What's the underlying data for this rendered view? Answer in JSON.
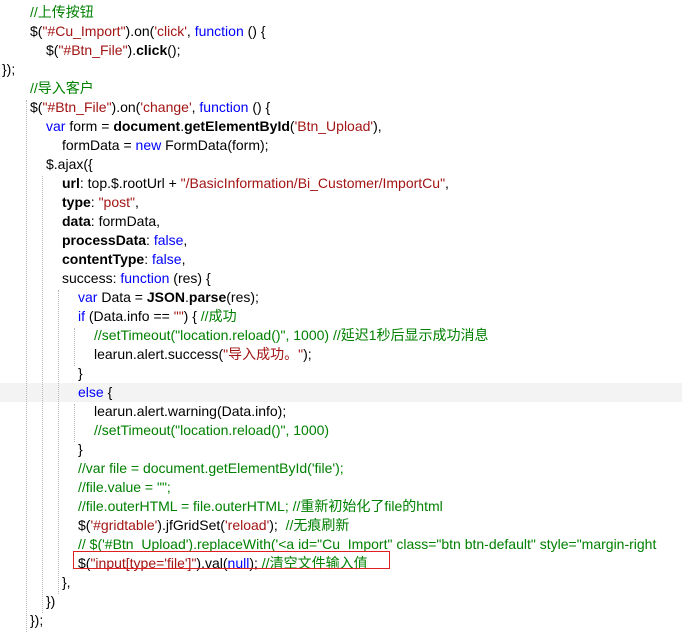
{
  "code": {
    "lines": [
      {
        "indent": 1,
        "tokens": [
          {
            "t": "//上传按钮",
            "c": "c"
          }
        ]
      },
      {
        "indent": 1,
        "tokens": [
          {
            "t": "$(",
            "c": "p"
          },
          {
            "t": "\"#Cu_Import\"",
            "c": "s"
          },
          {
            "t": ").on(",
            "c": "p"
          },
          {
            "t": "'click'",
            "c": "s"
          },
          {
            "t": ", ",
            "c": "p"
          },
          {
            "t": "function",
            "c": "k"
          },
          {
            "t": " () {",
            "c": "p"
          }
        ]
      },
      {
        "indent": 2,
        "tokens": [
          {
            "t": "$(",
            "c": "p"
          },
          {
            "t": "\"#Btn_File\"",
            "c": "s"
          },
          {
            "t": ").",
            "c": "p"
          },
          {
            "t": "click",
            "c": "b"
          },
          {
            "t": "();",
            "c": "p"
          }
        ]
      },
      {
        "indent": 0,
        "tokens": [
          {
            "t": "});",
            "c": "p"
          }
        ]
      },
      {
        "indent": 1,
        "tokens": [
          {
            "t": "//导入客户",
            "c": "c"
          }
        ]
      },
      {
        "indent": 1,
        "tokens": [
          {
            "t": "$(",
            "c": "p"
          },
          {
            "t": "\"#Btn_File\"",
            "c": "s"
          },
          {
            "t": ").on(",
            "c": "p"
          },
          {
            "t": "'change'",
            "c": "s"
          },
          {
            "t": ", ",
            "c": "p"
          },
          {
            "t": "function",
            "c": "k"
          },
          {
            "t": " () {",
            "c": "p"
          }
        ]
      },
      {
        "indent": 3,
        "tokens": [
          {
            "t": "var",
            "c": "k"
          },
          {
            "t": " form = ",
            "c": "p"
          },
          {
            "t": "document",
            "c": "b"
          },
          {
            "t": ".",
            "c": "p"
          },
          {
            "t": "getElementById",
            "c": "b"
          },
          {
            "t": "(",
            "c": "p"
          },
          {
            "t": "'Btn_Upload'",
            "c": "s"
          },
          {
            "t": "),",
            "c": "p"
          }
        ]
      },
      {
        "indent": 4,
        "tokens": [
          {
            "t": "formData = ",
            "c": "p"
          },
          {
            "t": "new",
            "c": "k"
          },
          {
            "t": " FormData(form);",
            "c": "p"
          }
        ]
      },
      {
        "indent": 3,
        "tokens": [
          {
            "t": "$.ajax({",
            "c": "p"
          }
        ]
      },
      {
        "indent": 4,
        "tokens": [
          {
            "t": "url",
            "c": "b"
          },
          {
            "t": ": top.$.rootUrl + ",
            "c": "p"
          },
          {
            "t": "\"/BasicInformation/Bi_Customer/ImportCu\"",
            "c": "s"
          },
          {
            "t": ",",
            "c": "p"
          }
        ]
      },
      {
        "indent": 4,
        "tokens": [
          {
            "t": "type",
            "c": "b"
          },
          {
            "t": ": ",
            "c": "p"
          },
          {
            "t": "\"post\"",
            "c": "s"
          },
          {
            "t": ",",
            "c": "p"
          }
        ]
      },
      {
        "indent": 4,
        "tokens": [
          {
            "t": "data",
            "c": "b"
          },
          {
            "t": ": formData,",
            "c": "p"
          }
        ]
      },
      {
        "indent": 4,
        "tokens": [
          {
            "t": "processData",
            "c": "b"
          },
          {
            "t": ": ",
            "c": "p"
          },
          {
            "t": "false",
            "c": "k"
          },
          {
            "t": ",",
            "c": "p"
          }
        ]
      },
      {
        "indent": 4,
        "tokens": [
          {
            "t": "contentType",
            "c": "b"
          },
          {
            "t": ": ",
            "c": "p"
          },
          {
            "t": "false",
            "c": "k"
          },
          {
            "t": ",",
            "c": "p"
          }
        ]
      },
      {
        "indent": 4,
        "tokens": [
          {
            "t": "success: ",
            "c": "p"
          },
          {
            "t": "function",
            "c": "k"
          },
          {
            "t": " (res) {",
            "c": "p"
          }
        ]
      },
      {
        "indent": 5,
        "tokens": [
          {
            "t": "var",
            "c": "k"
          },
          {
            "t": " Data = ",
            "c": "p"
          },
          {
            "t": "JSON",
            "c": "b"
          },
          {
            "t": ".",
            "c": "p"
          },
          {
            "t": "parse",
            "c": "b"
          },
          {
            "t": "(res);",
            "c": "p"
          }
        ]
      },
      {
        "indent": 5,
        "tokens": [
          {
            "t": "if",
            "c": "k"
          },
          {
            "t": " (Data.info == ",
            "c": "p"
          },
          {
            "t": "\"\"",
            "c": "s"
          },
          {
            "t": ") { ",
            "c": "p"
          },
          {
            "t": "//成功",
            "c": "c"
          }
        ]
      },
      {
        "indent": 6,
        "tokens": [
          {
            "t": "//setTimeout(\"location.reload()\", 1000) //延迟1秒后显示成功消息",
            "c": "c"
          }
        ]
      },
      {
        "indent": 6,
        "tokens": [
          {
            "t": "learun.alert.success(",
            "c": "p"
          },
          {
            "t": "\"导入成功。\"",
            "c": "s"
          },
          {
            "t": ");",
            "c": "p"
          }
        ]
      },
      {
        "indent": 5,
        "tokens": [
          {
            "t": "}",
            "c": "p"
          }
        ]
      },
      {
        "indent": 5,
        "hl": true,
        "tokens": [
          {
            "t": "else",
            "c": "k"
          },
          {
            "t": " {",
            "c": "p"
          }
        ]
      },
      {
        "indent": 6,
        "tokens": [
          {
            "t": "learun.alert.warning(Data.info);",
            "c": "p"
          }
        ]
      },
      {
        "indent": 6,
        "tokens": [
          {
            "t": "//setTimeout(\"location.reload()\", 1000)",
            "c": "c"
          }
        ]
      },
      {
        "indent": 5,
        "tokens": [
          {
            "t": "}",
            "c": "p"
          }
        ]
      },
      {
        "indent": 5,
        "tokens": [
          {
            "t": "//var file = document.getElementById('file');",
            "c": "c"
          }
        ]
      },
      {
        "indent": 5,
        "tokens": [
          {
            "t": "//file.value = \"\";",
            "c": "c"
          }
        ]
      },
      {
        "indent": 5,
        "tokens": [
          {
            "t": "//file.outerHTML = file.outerHTML; //重新初始化了file的html",
            "c": "c"
          }
        ]
      },
      {
        "indent": 5,
        "tokens": [
          {
            "t": "$(",
            "c": "p"
          },
          {
            "t": "'#gridtable'",
            "c": "s"
          },
          {
            "t": ").jfGridSet(",
            "c": "p"
          },
          {
            "t": "'reload'",
            "c": "s"
          },
          {
            "t": ");  ",
            "c": "p"
          },
          {
            "t": "//无痕刷新",
            "c": "c"
          }
        ]
      },
      {
        "indent": 5,
        "tokens": [
          {
            "t": "// $('#Btn_Upload').replaceWith('<a id=\"Cu_Import\" class=\"btn btn-default\" style=\"margin-right",
            "c": "c"
          }
        ]
      },
      {
        "indent": 5,
        "tokens": [
          {
            "t": "$(",
            "c": "p"
          },
          {
            "t": "\"input[type='file']\"",
            "c": "s"
          },
          {
            "t": ").val(",
            "c": "p"
          },
          {
            "t": "null",
            "c": "k"
          },
          {
            "t": "); ",
            "c": "p"
          },
          {
            "t": "//清空文件输入值",
            "c": "c"
          }
        ]
      },
      {
        "indent": 4,
        "tokens": [
          {
            "t": "},",
            "c": "p"
          }
        ]
      },
      {
        "indent": 3,
        "tokens": [
          {
            "t": "})",
            "c": "p"
          }
        ]
      },
      {
        "indent": 1,
        "tokens": [
          {
            "t": "});",
            "c": "p"
          }
        ]
      }
    ]
  },
  "colors": {
    "comment": "#008000",
    "string": "#a31515",
    "keyword": "#0000ff",
    "highlight_box": "#e02020",
    "current_line": "#f3f3f3"
  }
}
